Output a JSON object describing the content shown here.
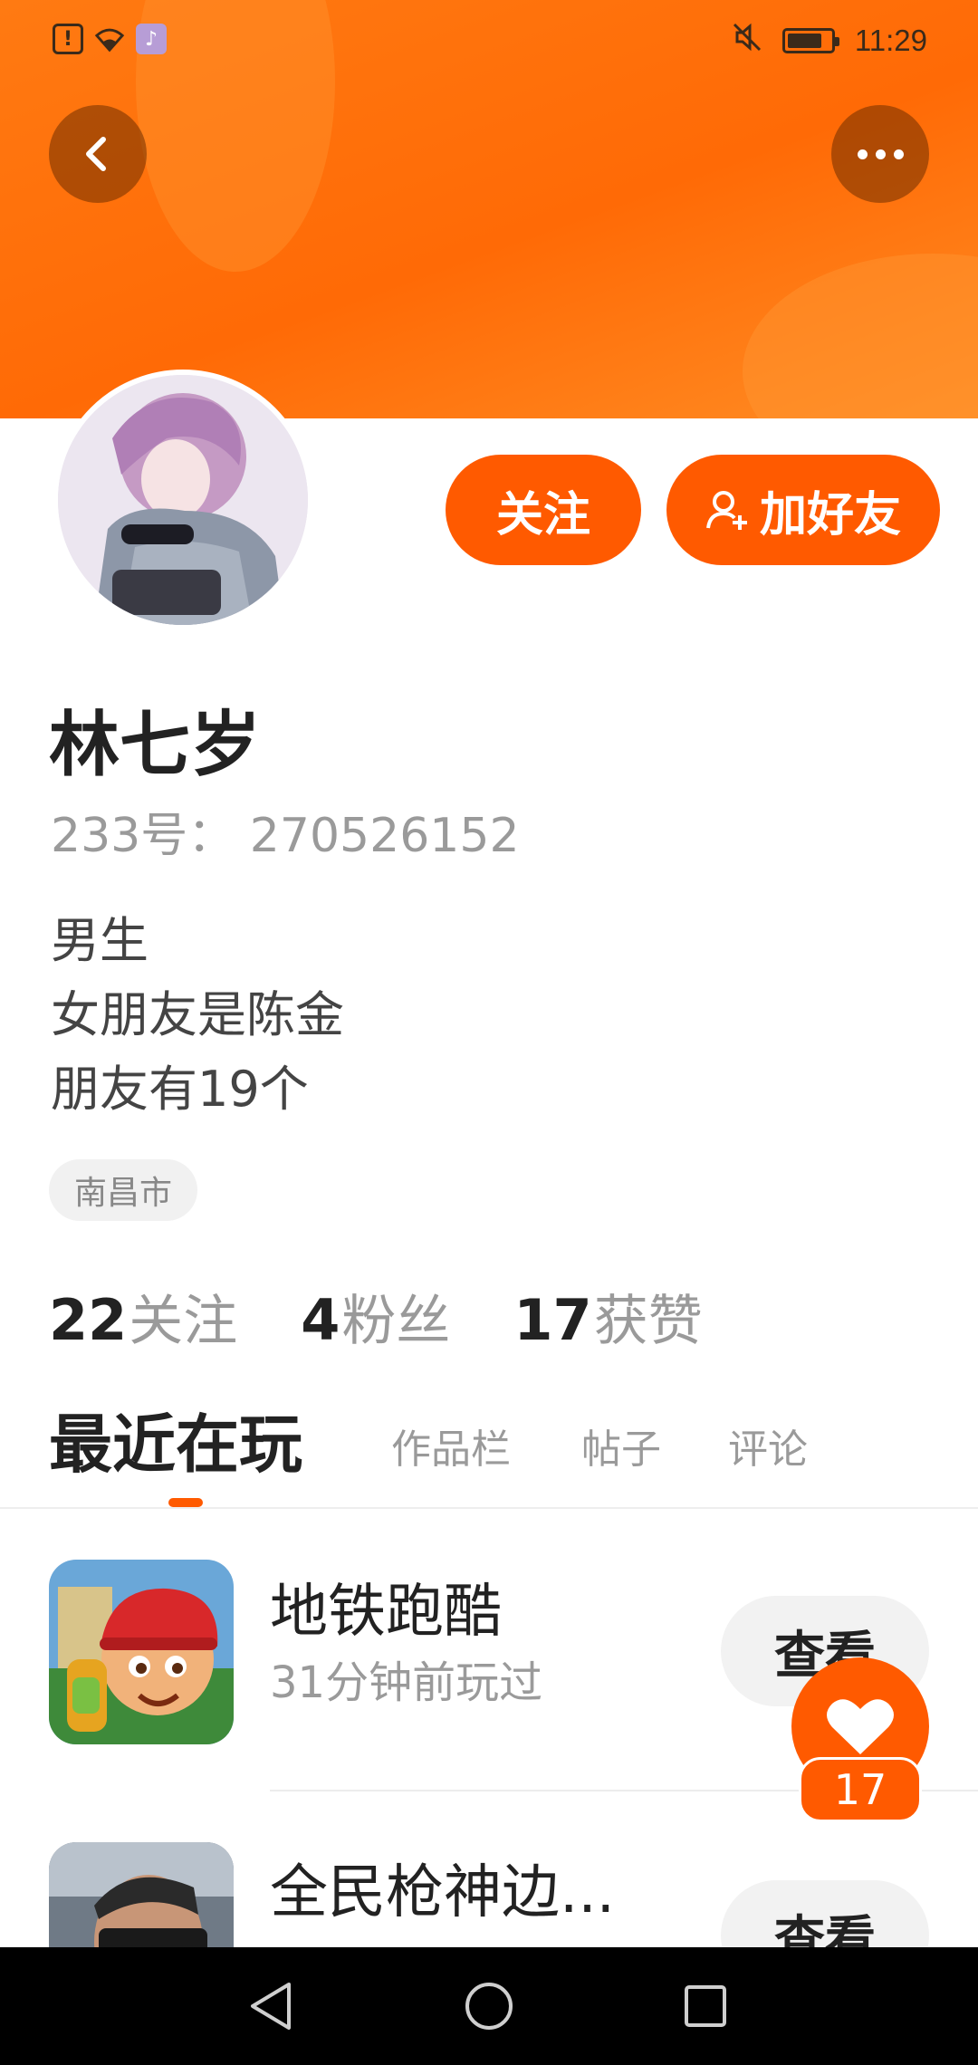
{
  "status_bar": {
    "time": "11:29",
    "battery_level": 0.8
  },
  "icons": {
    "back": "chevron-left-icon",
    "more": "more-horizontal-icon",
    "add_friend": "user-plus-icon",
    "like": "heart-icon"
  },
  "profile": {
    "name": "林七岁",
    "uid": "233号： 270526152",
    "bio": [
      "男生",
      "女朋友是陈金",
      "朋友有19个"
    ],
    "location": "南昌市"
  },
  "actions": {
    "follow_label": "关注",
    "add_friend_label": "加好友"
  },
  "stats": [
    {
      "count": "22",
      "label": "关注"
    },
    {
      "count": "4",
      "label": "粉丝"
    },
    {
      "count": "17",
      "label": "获赞"
    }
  ],
  "tabs": [
    {
      "label": "最近在玩",
      "active": true
    },
    {
      "label": "作品栏",
      "active": false
    },
    {
      "label": "帖子",
      "active": false
    },
    {
      "label": "评论",
      "active": false
    }
  ],
  "games": [
    {
      "title": "地铁跑酷",
      "subtitle": "31分钟前玩过",
      "button": "查看"
    },
    {
      "title": "全民枪神边...",
      "subtitle": "",
      "button": "查看"
    }
  ],
  "like_badge": {
    "count": "17"
  },
  "colors": {
    "accent": "#ff5a00",
    "header": "#ff7a12"
  }
}
